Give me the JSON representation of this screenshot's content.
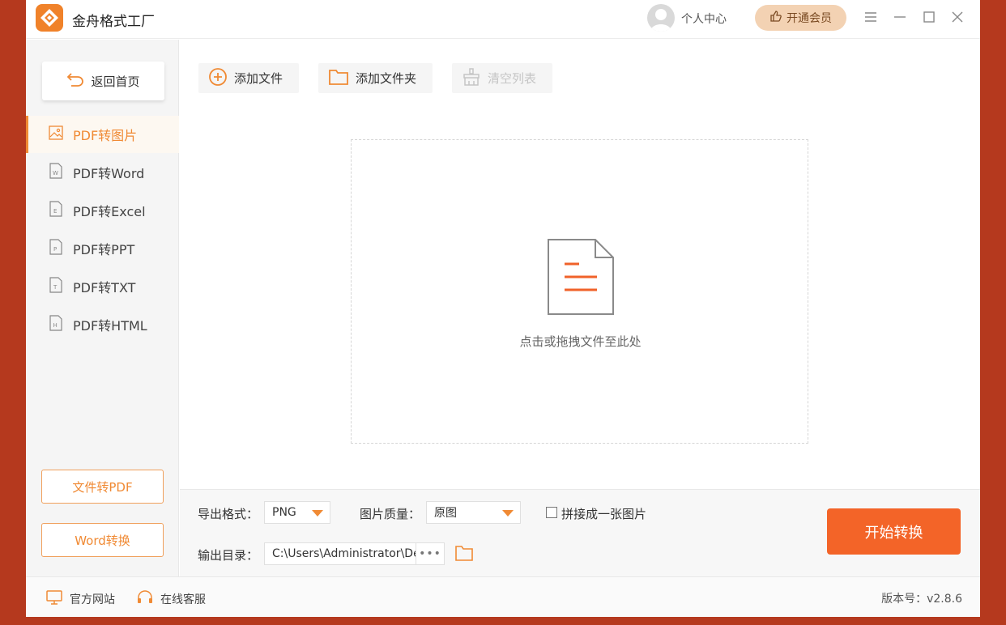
{
  "app": {
    "title": "金舟格式工厂"
  },
  "header": {
    "user_center": "个人中心",
    "vip_label": "开通会员"
  },
  "sidebar": {
    "home_label": "返回首页",
    "items": [
      {
        "label": "PDF转图片",
        "icon": "image-file-icon",
        "active": true
      },
      {
        "label": "PDF转Word",
        "icon": "word-file-icon",
        "active": false
      },
      {
        "label": "PDF转Excel",
        "icon": "excel-file-icon",
        "active": false
      },
      {
        "label": "PDF转PPT",
        "icon": "ppt-file-icon",
        "active": false
      },
      {
        "label": "PDF转TXT",
        "icon": "txt-file-icon",
        "active": false
      },
      {
        "label": "PDF转HTML",
        "icon": "html-file-icon",
        "active": false
      }
    ],
    "file_to_pdf_label": "文件转PDF",
    "word_convert_label": "Word转换"
  },
  "toolbar": {
    "add_file": "添加文件",
    "add_folder": "添加文件夹",
    "clear_list": "清空列表"
  },
  "dropzone": {
    "hint": "点击或拖拽文件至此处"
  },
  "settings": {
    "format_label": "导出格式：",
    "format_value": "PNG",
    "quality_label": "图片质量：",
    "quality_value": "原图",
    "merge_label": "拼接成一张图片",
    "merge_checked": false,
    "output_label": "输出目录：",
    "output_path": "C:\\Users\\Administrator\\Desktop",
    "more": "•••"
  },
  "start_button": "开始转换",
  "footer": {
    "official_site": "官方网站",
    "online_service": "在线客服",
    "version": "版本号：v2.8.6"
  },
  "colors": {
    "accent": "#f08a34",
    "start": "#f36428",
    "background": "#b5391e"
  }
}
